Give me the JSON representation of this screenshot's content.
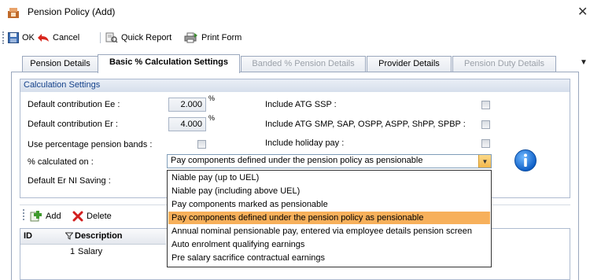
{
  "window": {
    "title": "Pension Policy (Add)",
    "close_glyph": "✕"
  },
  "toolbar": {
    "ok_label": "OK",
    "cancel_label": "Cancel",
    "quick_report_label": "Quick Report",
    "print_form_label": "Print Form"
  },
  "tabs": [
    {
      "label": "Pension Details",
      "state": "normal"
    },
    {
      "label": "Basic % Calculation Settings",
      "state": "active"
    },
    {
      "label": "Banded % Pension Details",
      "state": "disabled"
    },
    {
      "label": "Provider Details",
      "state": "normal"
    },
    {
      "label": "Pension Duty Details",
      "state": "disabled"
    }
  ],
  "settings": {
    "group_title": "Calculation Settings",
    "ee_label": "Default contribution  Ee :",
    "ee_value": "2.000",
    "er_label": "Default contribution  Er :",
    "er_value": "4.000",
    "percent_symbol": "%",
    "bands_label": "Use percentage pension bands :",
    "calc_on_label": "% calculated on :",
    "calc_on_value": "Pay components defined under the pension policy as pensionable",
    "er_ni_label": "Default Er NI Saving :",
    "atg_ssp_label": "Include ATG SSP :",
    "atg_smp_label": "Include ATG SMP, SAP, OSPP, ASPP, ShPP, SPBP :",
    "holiday_label": "Include holiday pay :"
  },
  "dropdown": {
    "options": [
      "Niable pay (up to UEL)",
      "Niable pay (including above UEL)",
      "Pay components marked as pensionable",
      "Pay components defined under the pension policy as pensionable",
      "Annual nominal pensionable pay, entered via employee details pension screen",
      "Auto enrolment qualifying earnings",
      "Pre salary sacrifice contractual earnings"
    ],
    "selected_index": 3
  },
  "grid": {
    "add_label": "Add",
    "delete_label": "Delete",
    "columns": [
      "ID",
      "Description"
    ],
    "rows": [
      {
        "id": "1",
        "description": "Salary"
      }
    ]
  },
  "colors": {
    "highlight": "#f7b05b",
    "group_title": "#15428b",
    "info_icon": "#1a73d9"
  }
}
